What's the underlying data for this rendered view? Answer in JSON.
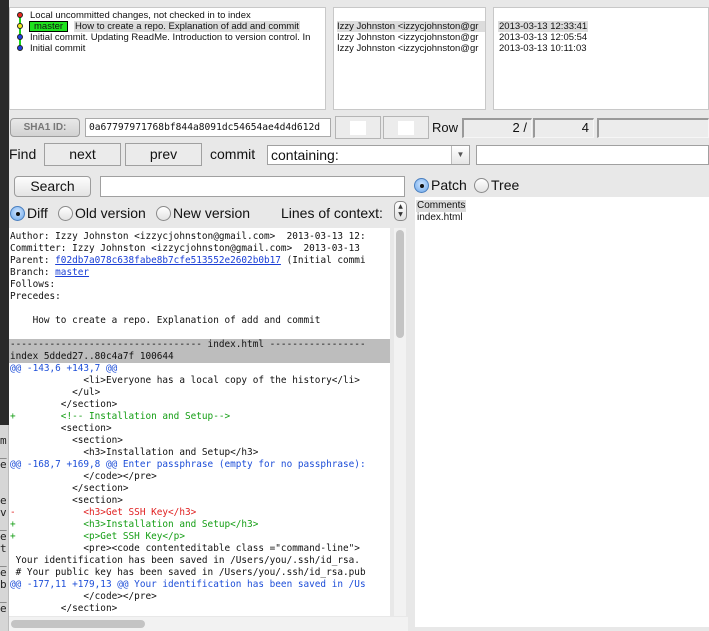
{
  "commits": [
    {
      "dot_color": "#e8281e",
      "subject": "Local uncommitted changes, not checked in to index",
      "branch": null,
      "author": "",
      "date": ""
    },
    {
      "dot_color": "#f2e61c",
      "subject": "How to create a repo. Explanation of add and commit",
      "branch": "master",
      "author": "Izzy Johnston <izzycjohnston@gr",
      "date": "2013-03-13 12:33:41",
      "selected": true
    },
    {
      "dot_color": "#1f3fe0",
      "subject": "Initial commit. Updating ReadMe. Introduction to version control. In",
      "branch": null,
      "author": "Izzy Johnston <izzycjohnston@gr",
      "date": "2013-03-13 12:05:54"
    },
    {
      "dot_color": "#1f3fe0",
      "subject": "Initial commit",
      "branch": null,
      "author": "Izzy Johnston <izzycjohnston@gr",
      "date": "2013-03-13 10:11:03"
    }
  ],
  "graph_line_color": "#1bd31b",
  "sha": {
    "button_label": "SHA1 ID:",
    "value": "0a67797971768bf844a8091dc54654ae4d4d612d"
  },
  "row": {
    "label": "Row",
    "current": "2 /",
    "total": "4"
  },
  "find": {
    "label": "Find",
    "next_label": "next",
    "prev_label": "prev",
    "commit_label": "commit",
    "mode_value": "containing:",
    "query_value": ""
  },
  "search": {
    "button_label": "Search",
    "value": ""
  },
  "view_mode": {
    "diff": "Diff",
    "old_version": "Old version",
    "new_version": "New version",
    "selected": "diff",
    "lines_of_context_label": "Lines of context:"
  },
  "patch_tree": {
    "patch": "Patch",
    "tree": "Tree",
    "selected": "patch"
  },
  "diff_lines": [
    {
      "type": "text",
      "text": "Author: Izzy Johnston <izzycjohnston@gmail.com>  2013-03-13 12:"
    },
    {
      "type": "text",
      "text": "Committer: Izzy Johnston <izzycjohnston@gmail.com>  2013-03-13"
    },
    {
      "type": "parent",
      "prefix": "Parent: ",
      "link": "f02db7a078c638fabe8b7cfe513552e2602b0b17",
      "suffix": " (Initial commi"
    },
    {
      "type": "branch",
      "prefix": "Branch: ",
      "link": "master"
    },
    {
      "type": "text",
      "text": "Follows:"
    },
    {
      "type": "text",
      "text": "Precedes:"
    },
    {
      "type": "text",
      "text": ""
    },
    {
      "type": "text",
      "text": "    How to create a repo. Explanation of add and commit"
    },
    {
      "type": "text",
      "text": ""
    },
    {
      "type": "filehdr",
      "text": "---------------------------------- index.html -----------------"
    },
    {
      "type": "filehdr2",
      "text": "index 5dded27..80c4a7f 100644"
    },
    {
      "type": "hunk",
      "text": "@@ -143,6 +143,7 @@"
    },
    {
      "type": "text",
      "text": "             <li>Everyone has a local copy of the history</li>"
    },
    {
      "type": "text",
      "text": "           </ul>"
    },
    {
      "type": "text",
      "text": "         </section>"
    },
    {
      "type": "add",
      "text": "+        <!-- Installation and Setup-->"
    },
    {
      "type": "text",
      "text": "         <section>"
    },
    {
      "type": "text",
      "text": "           <section>"
    },
    {
      "type": "text",
      "text": "             <h3>Installation and Setup</h3>"
    },
    {
      "type": "hunk",
      "text": "@@ -168,7 +169,8 @@ Enter passphrase (empty for no passphrase):"
    },
    {
      "type": "text",
      "text": "             </code></pre>"
    },
    {
      "type": "text",
      "text": "           </section>"
    },
    {
      "type": "text",
      "text": "           <section>"
    },
    {
      "type": "del",
      "text": "-            <h3>Get SSH Key</h3>"
    },
    {
      "type": "add",
      "text": "+            <h3>Installation and Setup</h3>"
    },
    {
      "type": "add",
      "text": "+            <p>Get SSH Key</p>"
    },
    {
      "type": "text",
      "text": "             <pre><code contenteditable class =\"command-line\">"
    },
    {
      "type": "text",
      "text": " Your identification has been saved in /Users/you/.ssh/id_rsa."
    },
    {
      "type": "text",
      "text": " # Your public key has been saved in /Users/you/.ssh/id_rsa.pub"
    },
    {
      "type": "hunk",
      "text": "@@ -177,11 +179,13 @@ Your identification has been saved in /Us"
    },
    {
      "type": "text",
      "text": "             </code></pre>"
    },
    {
      "type": "text",
      "text": "         </section>"
    }
  ],
  "files": [
    {
      "name": "Comments",
      "selected": true
    },
    {
      "name": "index.html",
      "selected": false
    }
  ],
  "background_window_chars": [
    "m",
    "_",
    "e",
    "",
    "",
    "e",
    "v",
    "_",
    "e",
    "t",
    "_",
    "e",
    "b",
    "_",
    "e"
  ]
}
